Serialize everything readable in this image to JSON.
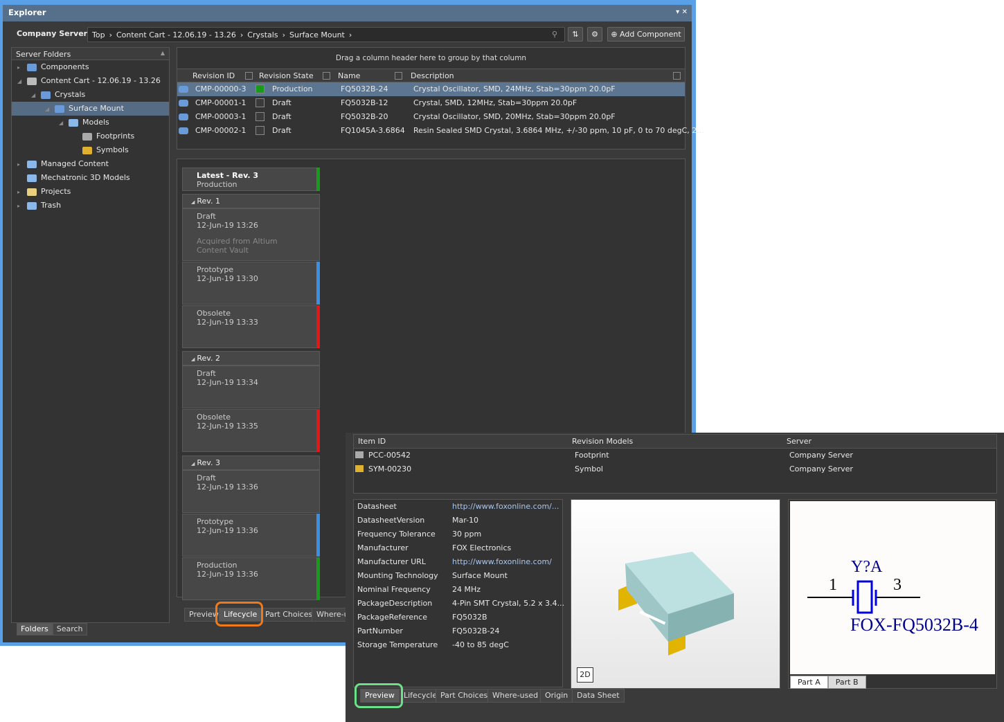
{
  "window": {
    "title": "Explorer",
    "controls": "▾ ✕"
  },
  "toolbar": {
    "server": "Company Server ▾",
    "breadcrumb": [
      "Top",
      "›",
      "Content Cart - 12.06.19 - 13.26",
      "›",
      "Crystals",
      "›",
      "Surface Mount",
      "›"
    ],
    "add_component": "Add Component"
  },
  "folders": {
    "header": "Server Folders",
    "items": [
      {
        "label": "Components",
        "level": 0,
        "exp": "▸",
        "icon": "component-icon"
      },
      {
        "label": "Content Cart - 12.06.19 - 13.26",
        "level": 0,
        "exp": "◢",
        "icon": "cart-icon"
      },
      {
        "label": "Crystals",
        "level": 1,
        "exp": "◢",
        "icon": "component-icon"
      },
      {
        "label": "Surface Mount",
        "level": 2,
        "exp": "◢",
        "icon": "component-icon",
        "selected": true
      },
      {
        "label": "Models",
        "level": 3,
        "exp": "◢",
        "icon": "folder-icon"
      },
      {
        "label": "Footprints",
        "level": 4,
        "exp": "",
        "icon": "footprint-icon"
      },
      {
        "label": "Symbols",
        "level": 4,
        "exp": "",
        "icon": "symbol-icon"
      },
      {
        "label": "Managed Content",
        "level": 0,
        "exp": "▸",
        "icon": "folder-icon"
      },
      {
        "label": "Mechatronic 3D Models",
        "level": 0,
        "exp": "",
        "icon": "folder-icon"
      },
      {
        "label": "Projects",
        "level": 0,
        "exp": "▸",
        "icon": "project-icon"
      },
      {
        "label": "Trash",
        "level": 0,
        "exp": "▸",
        "icon": "folder-icon"
      }
    ],
    "tabs": [
      "Folders",
      "Search"
    ]
  },
  "grid": {
    "group_hint": "Drag a column header here to group by that column",
    "columns": [
      "Revision ID",
      "Revision State",
      "Name",
      "Description"
    ],
    "rows": [
      {
        "id": "CMP-00000-3",
        "state": "Production",
        "color": "#1a9a1a",
        "name": "FQ5032B-24",
        "desc": "Crystal Oscillator, SMD, 24MHz, Stab=30ppm 20.0pF",
        "selected": true
      },
      {
        "id": "CMP-00001-1",
        "state": "Draft",
        "color": "",
        "name": "FQ5032B-12",
        "desc": "Crystal, SMD, 12MHz, Stab=30ppm 20.0pF"
      },
      {
        "id": "CMP-00003-1",
        "state": "Draft",
        "color": "",
        "name": "FQ5032B-20",
        "desc": "Crystal Oscillator, SMD, 20MHz, Stab=30ppm 20.0pF"
      },
      {
        "id": "CMP-00002-1",
        "state": "Draft",
        "color": "",
        "name": "FQ1045A-3.6864",
        "desc": "Resin Sealed SMD Crystal, 3.6864 MHz, +/-30 ppm, 10 pF, 0 to 70 degC, 2..."
      }
    ]
  },
  "lifecycle": {
    "latest": {
      "title": "Latest - Rev.  3",
      "state": "Production"
    },
    "revisions": [
      {
        "label": "Rev. 1",
        "states": [
          {
            "state": "Draft",
            "date": "12-Jun-19 13:26",
            "note": "Acquired from Altium Content Vault",
            "color": ""
          },
          {
            "state": "Prototype",
            "date": "12-Jun-19 13:30",
            "color": "#3f8fe0"
          },
          {
            "state": "Obsolete",
            "date": "12-Jun-19 13:33",
            "color": "#e01818"
          }
        ]
      },
      {
        "label": "Rev. 2",
        "states": [
          {
            "state": "Draft",
            "date": "12-Jun-19 13:34",
            "color": ""
          },
          {
            "state": "Obsolete",
            "date": "12-Jun-19 13:35",
            "color": "#e01818"
          }
        ]
      },
      {
        "label": "Rev. 3",
        "states": [
          {
            "state": "Draft",
            "date": "12-Jun-19 13:36",
            "color": ""
          },
          {
            "state": "Prototype",
            "date": "12-Jun-19 13:36",
            "color": "#3f8fe0"
          },
          {
            "state": "Production",
            "date": "12-Jun-19 13:36",
            "color": "#1a9a1a"
          }
        ]
      }
    ]
  },
  "bottom_tabs": [
    "Preview",
    "Lifecycle",
    "Part Choices",
    "Where-u"
  ],
  "detail": {
    "columns": [
      "Item ID",
      "Revision Models",
      "Server"
    ],
    "models": [
      {
        "id": "PCC-00542",
        "model": "Footprint",
        "server": "Company Server"
      },
      {
        "id": "SYM-00230",
        "model": "Symbol",
        "server": "Company Server"
      }
    ],
    "properties": [
      [
        "Datasheet",
        "http://www.foxonline.com/..."
      ],
      [
        "DatasheetVersion",
        "Mar-10"
      ],
      [
        "Frequency Tolerance",
        "30 ppm"
      ],
      [
        "Manufacturer",
        "FOX Electronics"
      ],
      [
        "Manufacturer URL",
        "http://www.foxonline.com/"
      ],
      [
        "Mounting Technology",
        "Surface Mount"
      ],
      [
        "Nominal Frequency",
        "24 MHz"
      ],
      [
        "PackageDescription",
        "4-Pin SMT Crystal, 5.2 x 3.4..."
      ],
      [
        "PackageReference",
        "FQ5032B"
      ],
      [
        "PartNumber",
        "FQ5032B-24"
      ],
      [
        "Storage Temperature",
        "-40 to 85 degC"
      ]
    ],
    "view_2d": "2D",
    "symbol": {
      "designator": "Y?A",
      "pin1": "1",
      "pin3": "3",
      "comment": "FOX-FQ5032B-4"
    },
    "part_tabs": [
      "Part A",
      "Part B"
    ],
    "tabs": [
      "Preview",
      "Lifecycle",
      "Part Choices",
      "Where-used",
      "Origin",
      "Data Sheet"
    ]
  },
  "colors": {
    "highlight_orange": "#f07a1a",
    "highlight_green": "#6de08a",
    "link": "#a8c8f0"
  }
}
